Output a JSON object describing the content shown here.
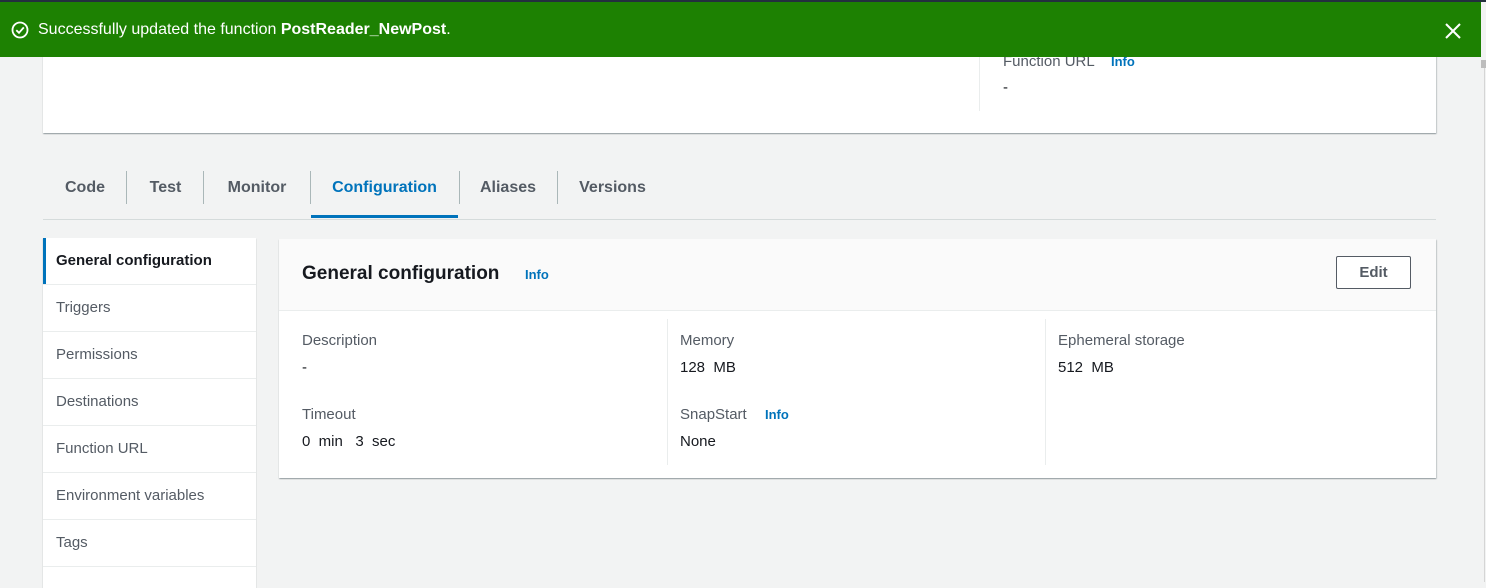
{
  "flash": {
    "message_prefix": "Successfully updated the function ",
    "function_name": "PostReader_NewPost",
    "message_suffix": ".",
    "icon": "check-circle-icon",
    "close_icon": "close-icon",
    "color": "#1d8102"
  },
  "overview": {
    "function_url_label": "Function URL",
    "function_url_info": "Info",
    "function_url_value": "-"
  },
  "tabs": [
    {
      "label": "Code"
    },
    {
      "label": "Test"
    },
    {
      "label": "Monitor"
    },
    {
      "label": "Configuration",
      "active": true
    },
    {
      "label": "Aliases"
    },
    {
      "label": "Versions"
    }
  ],
  "sidebar": {
    "items": [
      {
        "label": "General configuration",
        "active": true
      },
      {
        "label": "Triggers"
      },
      {
        "label": "Permissions"
      },
      {
        "label": "Destinations"
      },
      {
        "label": "Function URL"
      },
      {
        "label": "Environment variables"
      },
      {
        "label": "Tags"
      }
    ]
  },
  "general_config": {
    "title": "General configuration",
    "info": "Info",
    "edit_label": "Edit",
    "description_label": "Description",
    "description_value": "-",
    "timeout_label": "Timeout",
    "timeout_value": "0  min   3  sec",
    "memory_label": "Memory",
    "memory_value": "128  MB",
    "snapstart_label": "SnapStart",
    "snapstart_info": "Info",
    "snapstart_value": "None",
    "ephemeral_label": "Ephemeral storage",
    "ephemeral_value": "512  MB"
  },
  "colors": {
    "accent": "#0073bb",
    "success": "#1d8102"
  }
}
